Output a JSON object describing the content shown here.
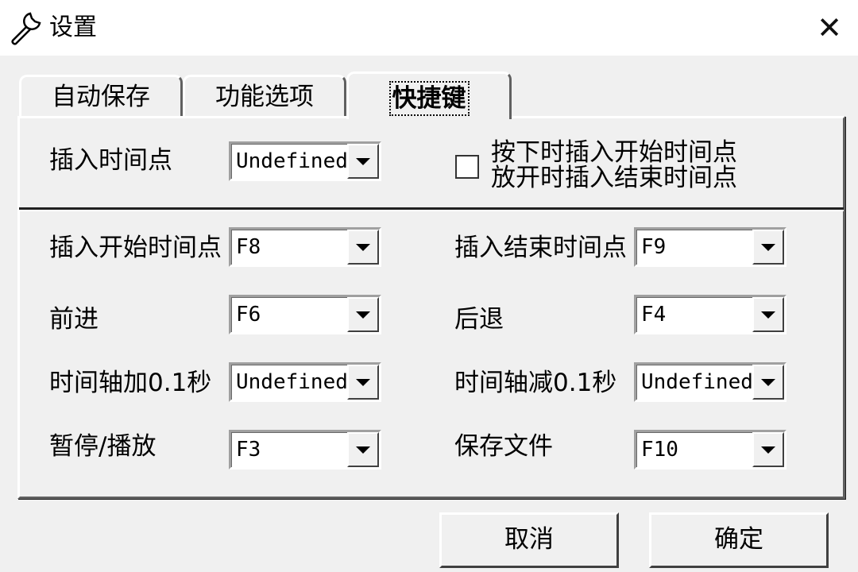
{
  "window": {
    "title": "设置",
    "title_icon": "wrench-icon",
    "close_glyph": "✕"
  },
  "tabs": [
    {
      "label": "自动保存",
      "active": false
    },
    {
      "label": "功能选项",
      "active": false
    },
    {
      "label": "快捷键",
      "active": true
    }
  ],
  "top_section": {
    "insert_time_point": {
      "label": "插入时间点",
      "value": "Undefined"
    },
    "checkbox": {
      "line1": "按下时插入开始时间点",
      "line2": "放开时插入结束时间点",
      "checked": false
    }
  },
  "shortcuts": [
    {
      "label": "插入开始时间点",
      "value": "F8"
    },
    {
      "label": "插入结束时间点",
      "value": "F9"
    },
    {
      "label": "前进",
      "value": "F6"
    },
    {
      "label": "后退",
      "value": "F4"
    },
    {
      "label": "时间轴加0.1秒",
      "value": "Undefined"
    },
    {
      "label": "时间轴减0.1秒",
      "value": "Undefined"
    },
    {
      "label": "暂停/播放",
      "value": "F3"
    },
    {
      "label": "保存文件",
      "value": "F10"
    }
  ],
  "buttons": {
    "cancel": "取消",
    "ok": "确定"
  }
}
